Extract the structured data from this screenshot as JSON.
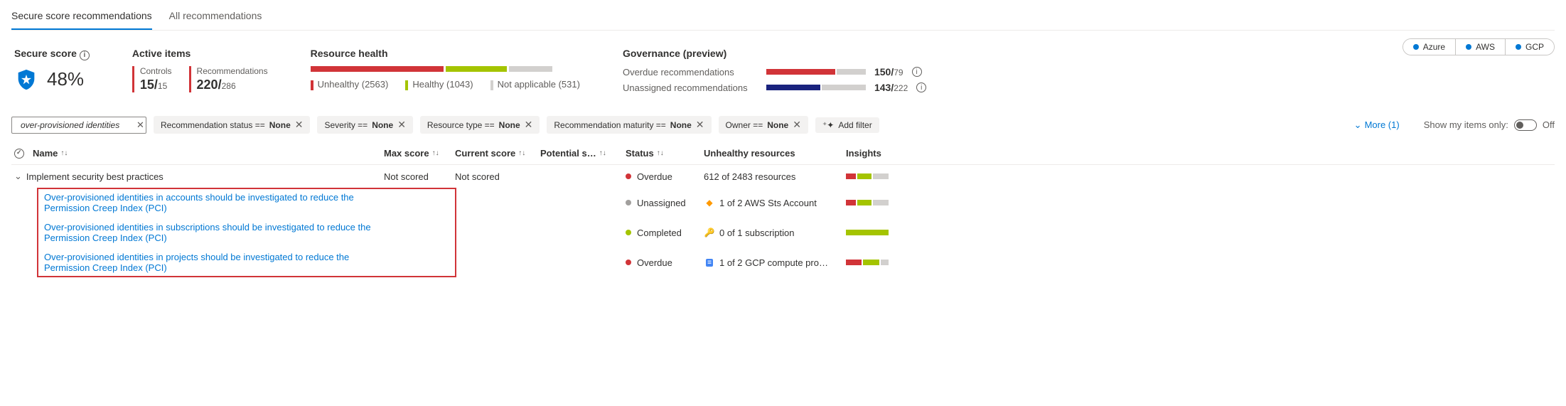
{
  "tabs": {
    "active": "Secure score recommendations",
    "other": "All recommendations"
  },
  "secure_score": {
    "title": "Secure score",
    "value": "48%"
  },
  "active_items": {
    "title": "Active items",
    "controls": {
      "label": "Controls",
      "num": "15",
      "den": "15"
    },
    "recs": {
      "label": "Recommendations",
      "num": "220",
      "den": "286"
    }
  },
  "resource_health": {
    "title": "Resource health",
    "unhealthy": "Unhealthy (2563)",
    "healthy": "Healthy (1043)",
    "na": "Not applicable (531)"
  },
  "governance": {
    "title": "Governance (preview)",
    "overdue": {
      "label": "Overdue recommendations",
      "num": "150",
      "den": "79"
    },
    "unassigned": {
      "label": "Unassigned recommendations",
      "num": "143",
      "den": "222"
    }
  },
  "clouds": {
    "azure": "Azure",
    "aws": "AWS",
    "gcp": "GCP"
  },
  "search": {
    "value": "over-provisioned identities"
  },
  "filters": {
    "status": {
      "label": "Recommendation status ==",
      "val": "None"
    },
    "severity": {
      "label": "Severity ==",
      "val": "None"
    },
    "restype": {
      "label": "Resource type ==",
      "val": "None"
    },
    "maturity": {
      "label": "Recommendation maturity ==",
      "val": "None"
    },
    "owner": {
      "label": "Owner ==",
      "val": "None"
    },
    "add": "Add filter",
    "more": "More (1)"
  },
  "show_only": {
    "label": "Show my items only:",
    "state": "Off"
  },
  "columns": {
    "name": "Name",
    "max": "Max score",
    "current": "Current score",
    "potential": "Potential s…",
    "status": "Status",
    "unhealthy": "Unhealthy resources",
    "insights": "Insights"
  },
  "group": {
    "name": "Implement security best practices",
    "max": "Not scored",
    "current": "Not scored",
    "status": "Overdue",
    "resources": "612 of 2483 resources"
  },
  "rows": [
    {
      "name": "Over-provisioned identities in accounts should be investigated to reduce the Permission Creep Index (PCI)",
      "status": "Unassigned",
      "status_color": "#a19f9d",
      "res_text": "1 of 2 AWS Sts Account",
      "res_icon": "aws-icon",
      "bar": [
        [
          "#d13438",
          25
        ],
        [
          "#a4c400",
          35
        ],
        [
          "#d2d0ce",
          40
        ]
      ]
    },
    {
      "name": "Over-provisioned identities in subscriptions should be investigated to reduce the Permission Creep Index (PCI)",
      "status": "Completed",
      "status_color": "#a4c400",
      "res_text": "0 of 1 subscription",
      "res_icon": "key-icon",
      "bar": [
        [
          "#a4c400",
          100
        ]
      ]
    },
    {
      "name": "Over-provisioned identities in projects should be investigated to reduce the Permission Creep Index (PCI)",
      "status": "Overdue",
      "status_color": "#d13438",
      "res_text": "1 of 2 GCP compute pro…",
      "res_icon": "gcp-icon",
      "bar": [
        [
          "#d13438",
          40
        ],
        [
          "#a4c400",
          40
        ],
        [
          "#d2d0ce",
          20
        ]
      ]
    }
  ]
}
